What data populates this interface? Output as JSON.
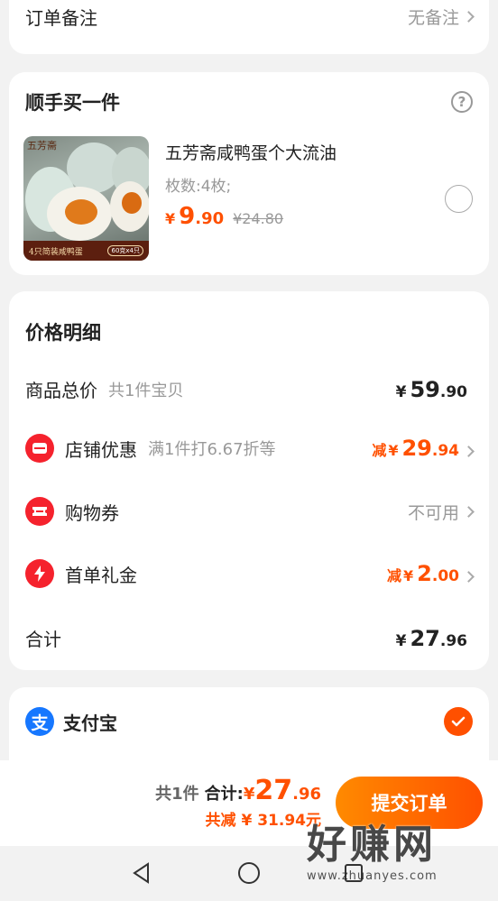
{
  "order_note": {
    "label": "订单备注",
    "value": "无备注"
  },
  "addon": {
    "title": "顺手买一件",
    "help_icon": "question-circle-icon",
    "product": {
      "image_brand": "五芳斋",
      "image_caption": "4只简装咸鸭蛋",
      "image_badge": "60克x4只",
      "name": "五芳斋咸鸭蛋个大流油",
      "spec": "枚数:4枚;",
      "currency": "¥",
      "price_int": "9",
      "price_dec": ".90",
      "orig_price": "¥24.80",
      "selected": false
    }
  },
  "price_detail": {
    "title": "价格明细",
    "rows": [
      {
        "label": "商品总价",
        "sub": "共1件宝贝",
        "currency": "¥",
        "int": "59",
        "dec": ".90",
        "prefix": ""
      },
      {
        "label": "店铺优惠",
        "sub": "满1件打6.67折等",
        "currency": "¥",
        "int": "29",
        "dec": ".94",
        "prefix": "减"
      },
      {
        "label": "购物券",
        "value": "不可用"
      },
      {
        "label": "首单礼金",
        "currency": "¥",
        "int": "2",
        "dec": ".00",
        "prefix": "减"
      },
      {
        "label": "合计",
        "currency": "¥",
        "int": "27",
        "dec": ".96"
      }
    ]
  },
  "payment": {
    "label": "支付宝",
    "selected": true
  },
  "footer": {
    "count": "共1件",
    "total_label": "合计:",
    "currency": "¥",
    "total_int": "27",
    "total_dec": ".96",
    "saved": "共减 ¥ 31.94元",
    "submit": "提交订单"
  },
  "watermark": {
    "text": "好赚网",
    "url": "www.zhuanyes.com"
  },
  "colors": {
    "accent": "#ff5000",
    "red": "#f5222d",
    "alipay": "#1677ff"
  }
}
